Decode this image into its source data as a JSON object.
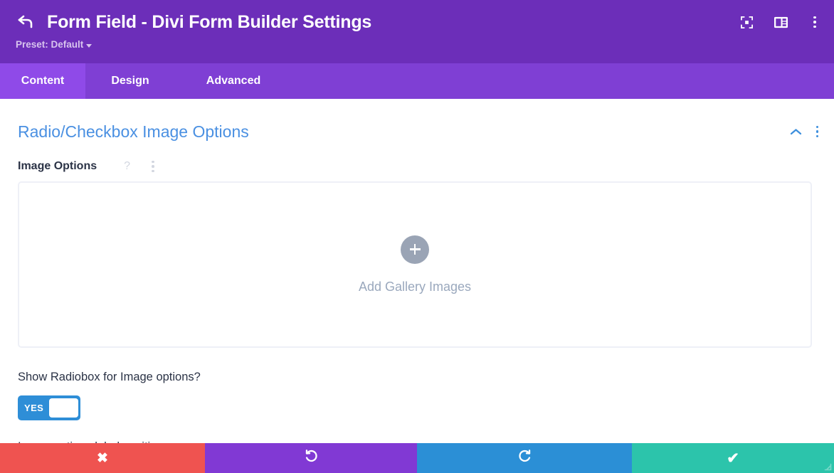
{
  "header": {
    "back_icon": "back-arrow-icon",
    "title": "Form Field - Divi Form Builder Settings",
    "preset_label": "Preset: Default",
    "actions": [
      {
        "icon": "focus-target-icon",
        "name": "focus-view-button"
      },
      {
        "icon": "panel-layout-icon",
        "name": "layout-view-button"
      },
      {
        "icon": "kebab-menu-icon",
        "name": "header-overflow-menu"
      }
    ]
  },
  "tabs": [
    {
      "label": "Content",
      "active": true
    },
    {
      "label": "Design",
      "active": false
    },
    {
      "label": "Advanced",
      "active": false
    }
  ],
  "section": {
    "title": "Radio/Checkbox Image Options",
    "collapse_icon": "chevron-up-icon",
    "overflow_icon": "kebab-menu-icon"
  },
  "image_options": {
    "label": "Image Options",
    "help_icon": "question-mark-icon",
    "overflow_icon": "kebab-menu-icon",
    "gallery": {
      "add_icon": "plus-icon",
      "add_label": "Add Gallery Images"
    }
  },
  "radiobox_toggle": {
    "question": "Show Radiobox for Image options?",
    "value": "YES"
  },
  "next_field": {
    "label": "Image options label position"
  },
  "footer": {
    "buttons": [
      {
        "name": "cancel-button",
        "icon": "close-x-icon",
        "glyph": "✖",
        "color": "#ef5350"
      },
      {
        "name": "undo-button",
        "icon": "undo-arrow-icon",
        "glyph": "",
        "color": "#8139d4"
      },
      {
        "name": "redo-button",
        "icon": "redo-arrow-icon",
        "glyph": "",
        "color": "#2b8fd6"
      },
      {
        "name": "save-button",
        "icon": "checkmark-icon",
        "glyph": "✔",
        "color": "#2cc4ab"
      }
    ],
    "resize_grip_icon": "resize-grip-icon"
  },
  "colors": {
    "header_purple": "#6c2eb9",
    "tabbar_purple": "#7f3fd4",
    "tab_active_purple": "#8f4ae8",
    "section_blue": "#4a90e2",
    "toggle_blue": "#2e8ed7",
    "muted_gray": "#9aa8bd"
  }
}
